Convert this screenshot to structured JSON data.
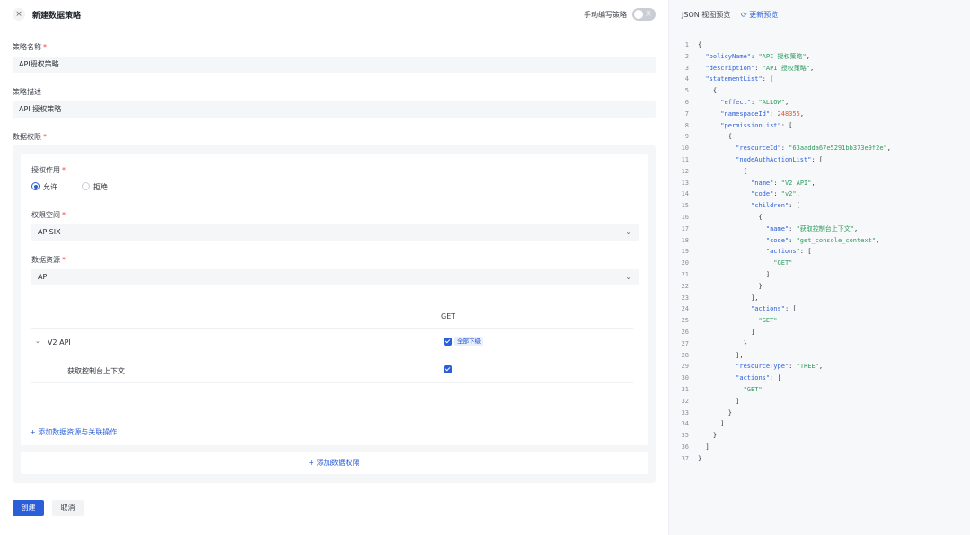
{
  "header": {
    "close_icon": "×",
    "title": "新建数据策略",
    "manual_label": "手动编写策略",
    "toggle_text": "关"
  },
  "form": {
    "policy_name_label": "策略名称",
    "policy_name_value": "API授权策略",
    "description_label": "策略描述",
    "description_value": "API 授权策略",
    "data_permission_label": "数据权限",
    "required_mark": "*"
  },
  "permission": {
    "effect_label": "授权作用",
    "effect_options": [
      "允许",
      "拒绝"
    ],
    "effect_selected": "允许",
    "namespace_label": "权限空间",
    "namespace_value": "APISIX",
    "resource_label": "数据资源",
    "resource_value": "API",
    "column_header": "GET",
    "tree": [
      {
        "name": "V2 API",
        "expanded": true,
        "checked": true,
        "badge": "全部下级"
      },
      {
        "name": "获取控制台上下文",
        "checked": true
      }
    ],
    "add_resource_link": "+ 添加数据资源与关联操作",
    "add_permission_link": "+ 添加数据权限"
  },
  "footer": {
    "create_label": "创建",
    "cancel_label": "取消"
  },
  "json_preview": {
    "title": "JSON 视图预览",
    "refresh_label": "更新预览",
    "lines": [
      {
        "no": "1",
        "indent": 0,
        "parts": [
          [
            "p",
            "{"
          ]
        ]
      },
      {
        "no": "2",
        "indent": 1,
        "parts": [
          [
            "k",
            "\"policyName\""
          ],
          [
            "p",
            ": "
          ],
          [
            "s",
            "\"API 授权策略\""
          ],
          [
            "p",
            ","
          ]
        ]
      },
      {
        "no": "3",
        "indent": 1,
        "parts": [
          [
            "k",
            "\"description\""
          ],
          [
            "p",
            ": "
          ],
          [
            "s",
            "\"API 授权策略\""
          ],
          [
            "p",
            ","
          ]
        ]
      },
      {
        "no": "4",
        "indent": 1,
        "parts": [
          [
            "k",
            "\"statementList\""
          ],
          [
            "p",
            ": ["
          ]
        ]
      },
      {
        "no": "5",
        "indent": 2,
        "parts": [
          [
            "p",
            "{"
          ]
        ]
      },
      {
        "no": "6",
        "indent": 3,
        "parts": [
          [
            "k",
            "\"effect\""
          ],
          [
            "p",
            ": "
          ],
          [
            "s",
            "\"ALLOW\""
          ],
          [
            "p",
            ","
          ]
        ]
      },
      {
        "no": "7",
        "indent": 3,
        "parts": [
          [
            "k",
            "\"namespaceId\""
          ],
          [
            "p",
            ": "
          ],
          [
            "n",
            "248355"
          ],
          [
            "p",
            ","
          ]
        ]
      },
      {
        "no": "8",
        "indent": 3,
        "parts": [
          [
            "k",
            "\"permissionList\""
          ],
          [
            "p",
            ": ["
          ]
        ]
      },
      {
        "no": "9",
        "indent": 4,
        "parts": [
          [
            "p",
            "{"
          ]
        ]
      },
      {
        "no": "10",
        "indent": 5,
        "parts": [
          [
            "k",
            "\"resourceId\""
          ],
          [
            "p",
            ": "
          ],
          [
            "s",
            "\"63aadda67e5291bb373e9f2e\""
          ],
          [
            "p",
            ","
          ]
        ]
      },
      {
        "no": "11",
        "indent": 5,
        "parts": [
          [
            "k",
            "\"nodeAuthActionList\""
          ],
          [
            "p",
            ": ["
          ]
        ]
      },
      {
        "no": "12",
        "indent": 6,
        "parts": [
          [
            "p",
            "{"
          ]
        ]
      },
      {
        "no": "13",
        "indent": 7,
        "parts": [
          [
            "k",
            "\"name\""
          ],
          [
            "p",
            ": "
          ],
          [
            "s",
            "\"V2 API\""
          ],
          [
            "p",
            ","
          ]
        ]
      },
      {
        "no": "14",
        "indent": 7,
        "parts": [
          [
            "k",
            "\"code\""
          ],
          [
            "p",
            ": "
          ],
          [
            "s",
            "\"v2\""
          ],
          [
            "p",
            ","
          ]
        ]
      },
      {
        "no": "15",
        "indent": 7,
        "parts": [
          [
            "k",
            "\"children\""
          ],
          [
            "p",
            ": ["
          ]
        ]
      },
      {
        "no": "16",
        "indent": 8,
        "parts": [
          [
            "p",
            "{"
          ]
        ]
      },
      {
        "no": "17",
        "indent": 9,
        "parts": [
          [
            "k",
            "\"name\""
          ],
          [
            "p",
            ": "
          ],
          [
            "s",
            "\"获取控制台上下文\""
          ],
          [
            "p",
            ","
          ]
        ]
      },
      {
        "no": "18",
        "indent": 9,
        "parts": [
          [
            "k",
            "\"code\""
          ],
          [
            "p",
            ": "
          ],
          [
            "s",
            "\"get_console_context\""
          ],
          [
            "p",
            ","
          ]
        ]
      },
      {
        "no": "19",
        "indent": 9,
        "parts": [
          [
            "k",
            "\"actions\""
          ],
          [
            "p",
            ": ["
          ]
        ]
      },
      {
        "no": "20",
        "indent": 10,
        "parts": [
          [
            "s",
            "\"GET\""
          ]
        ]
      },
      {
        "no": "21",
        "indent": 9,
        "parts": [
          [
            "p",
            "]"
          ]
        ]
      },
      {
        "no": "22",
        "indent": 8,
        "parts": [
          [
            "p",
            "}"
          ]
        ]
      },
      {
        "no": "23",
        "indent": 7,
        "parts": [
          [
            "p",
            "],"
          ]
        ]
      },
      {
        "no": "24",
        "indent": 7,
        "parts": [
          [
            "k",
            "\"actions\""
          ],
          [
            "p",
            ": ["
          ]
        ]
      },
      {
        "no": "25",
        "indent": 8,
        "parts": [
          [
            "s",
            "\"GET\""
          ]
        ]
      },
      {
        "no": "26",
        "indent": 7,
        "parts": [
          [
            "p",
            "]"
          ]
        ]
      },
      {
        "no": "27",
        "indent": 6,
        "parts": [
          [
            "p",
            "}"
          ]
        ]
      },
      {
        "no": "28",
        "indent": 5,
        "parts": [
          [
            "p",
            "],"
          ]
        ]
      },
      {
        "no": "29",
        "indent": 5,
        "parts": [
          [
            "k",
            "\"resourceType\""
          ],
          [
            "p",
            ": "
          ],
          [
            "s",
            "\"TREE\""
          ],
          [
            "p",
            ","
          ]
        ]
      },
      {
        "no": "30",
        "indent": 5,
        "parts": [
          [
            "k",
            "\"actions\""
          ],
          [
            "p",
            ": ["
          ]
        ]
      },
      {
        "no": "31",
        "indent": 6,
        "parts": [
          [
            "s",
            "\"GET\""
          ]
        ]
      },
      {
        "no": "32",
        "indent": 5,
        "parts": [
          [
            "p",
            "]"
          ]
        ]
      },
      {
        "no": "33",
        "indent": 4,
        "parts": [
          [
            "p",
            "}"
          ]
        ]
      },
      {
        "no": "34",
        "indent": 3,
        "parts": [
          [
            "p",
            "]"
          ]
        ]
      },
      {
        "no": "35",
        "indent": 2,
        "parts": [
          [
            "p",
            "}"
          ]
        ]
      },
      {
        "no": "36",
        "indent": 1,
        "parts": [
          [
            "p",
            "]"
          ]
        ]
      },
      {
        "no": "37",
        "indent": 0,
        "parts": [
          [
            "p",
            "}"
          ]
        ]
      }
    ]
  },
  "colors": {
    "primary": "#2b5fd9",
    "required": "#f53f3f",
    "json_key": "#2b5fd9",
    "json_string": "#2e9b5e",
    "json_number": "#e0562b"
  }
}
